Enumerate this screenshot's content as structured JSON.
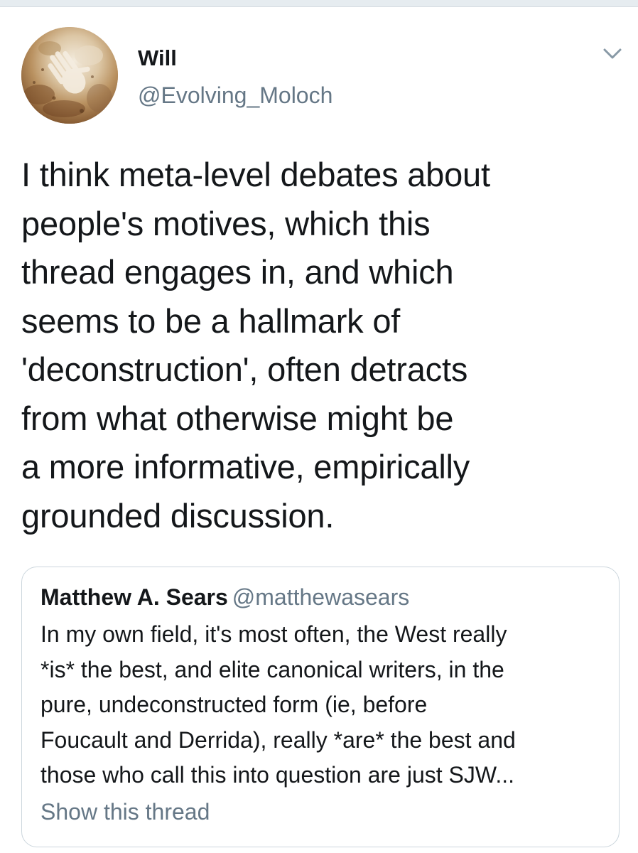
{
  "tweet": {
    "author": {
      "name": "Will",
      "handle": "@Evolving_Moloch",
      "avatar_icon": "cave-handprint-avatar"
    },
    "menu_icon": "chevron-down-icon",
    "text": "I think meta-level debates about\npeople's motives, which this\nthread engages in, and which\nseems to be a hallmark of\n'deconstruction', often detracts\nfrom what otherwise might be\na more informative, empirically\ngrounded discussion."
  },
  "quoted_tweet": {
    "author_name": "Matthew A. Sears",
    "author_handle": "@matthewasears",
    "text": "In my own field, it's most often, the West really\n*is* the best, and elite canonical writers, in the\npure, undeconstructed form (ie, before\nFoucault and Derrida), really *are* the best and\nthose who call this into question are just SJW...",
    "show_thread_label": "Show this thread"
  },
  "colors": {
    "text_primary": "#14171a",
    "text_secondary": "#657786",
    "border": "#ccd6dd",
    "divider": "#e6ecf0"
  }
}
